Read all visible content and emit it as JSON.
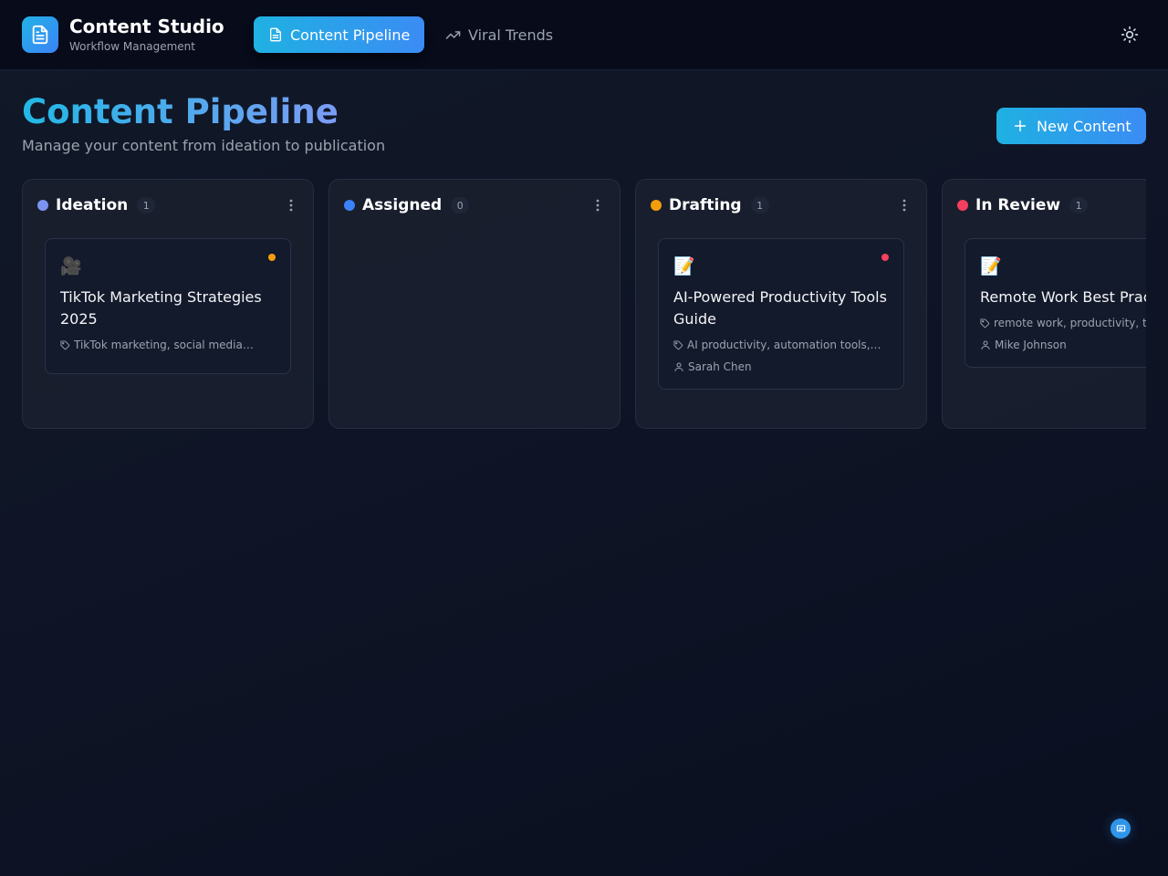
{
  "app": {
    "title": "Content Studio",
    "subtitle": "Workflow Management",
    "logo_icon": "document-icon"
  },
  "nav": {
    "tabs": [
      {
        "label": "Content Pipeline",
        "icon": "document-icon",
        "active": true
      },
      {
        "label": "Viral Trends",
        "icon": "trending-up-icon",
        "active": false
      }
    ],
    "theme_toggle_icon": "sun-icon"
  },
  "page": {
    "title": "Content Pipeline",
    "subtitle": "Manage your content from ideation to publication",
    "new_button_label": "New Content"
  },
  "columns": [
    {
      "title": "Ideation",
      "count": "1",
      "dot_color": "#7c94f0",
      "cards": [
        {
          "emoji": "🎥",
          "priority_color": "#f59e0b",
          "title": "TikTok Marketing Strategies 2025",
          "tags": "TikTok marketing, social media…",
          "assignee": ""
        }
      ]
    },
    {
      "title": "Assigned",
      "count": "0",
      "dot_color": "#3b82f6",
      "cards": []
    },
    {
      "title": "Drafting",
      "count": "1",
      "dot_color": "#f59e0b",
      "cards": [
        {
          "emoji": "📝",
          "priority_color": "#f43f5e",
          "title": "AI-Powered Productivity Tools Guide",
          "tags": "AI productivity, automation tools,…",
          "assignee": "Sarah Chen"
        }
      ]
    },
    {
      "title": "In Review",
      "count": "1",
      "dot_color": "#f43f5e",
      "cards": [
        {
          "emoji": "📝",
          "priority_color": "",
          "title": "Remote Work Best Practices",
          "tags": "remote work, productivity, team",
          "assignee": "Mike Johnson"
        }
      ]
    }
  ],
  "colors": {
    "accent": "#22b3e6",
    "accent_secondary": "#3b82f6"
  },
  "chat_icon": "chat-icon"
}
